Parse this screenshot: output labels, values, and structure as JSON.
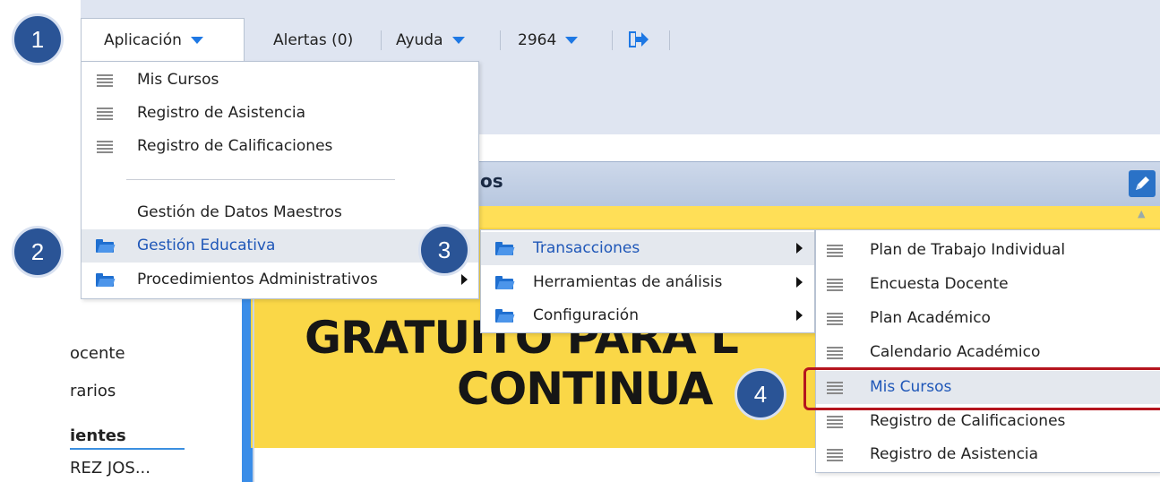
{
  "topbar": {
    "aplicacion_label": "Aplicación",
    "alertas_label": "Alertas (0)",
    "ayuda_label": "Ayuda",
    "user_code": "2964"
  },
  "panel": {
    "title_fragment": "os",
    "banner_line1": "GRATUITO PARA L",
    "banner_line2": "CONTINUA"
  },
  "left_side": {
    "item1": "ocente",
    "item2": "rarios",
    "section": "ientes",
    "person": "REZ JOS..."
  },
  "menu_aplicacion": {
    "items": [
      {
        "label": "Mis Cursos",
        "icon": "list-icon"
      },
      {
        "label": "Registro de Asistencia",
        "icon": "list-icon"
      },
      {
        "label": "Registro de Calificaciones",
        "icon": "list-icon"
      }
    ],
    "group_title": "Gestión de Datos Maestros",
    "folders": [
      {
        "label": "Gestión Educativa",
        "icon": "folder-icon",
        "highlighted": true
      },
      {
        "label": "Procedimientos Administrativos",
        "icon": "folder-icon"
      }
    ]
  },
  "menu_gestion_educativa": {
    "items": [
      {
        "label": "Transacciones",
        "icon": "folder-icon",
        "highlighted": true
      },
      {
        "label": "Herramientas de análisis",
        "icon": "folder-icon"
      },
      {
        "label": "Configuración",
        "icon": "folder-icon"
      }
    ]
  },
  "menu_transacciones": {
    "items": [
      {
        "label": "Plan de Trabajo Individual",
        "icon": "list-icon"
      },
      {
        "label": "Encuesta Docente",
        "icon": "list-icon"
      },
      {
        "label": "Plan Académico",
        "icon": "list-icon"
      },
      {
        "label": "Calendario Académico",
        "icon": "list-icon"
      },
      {
        "label": "Mis Cursos",
        "icon": "list-icon",
        "highlighted": true
      },
      {
        "label": "Registro de Calificaciones",
        "icon": "list-icon"
      },
      {
        "label": "Registro de Asistencia",
        "icon": "list-icon"
      }
    ]
  },
  "step_markers": [
    "1",
    "2",
    "3",
    "4"
  ],
  "colors": {
    "accent": "#1e78e4",
    "bubble": "#2a5496",
    "highlight_box": "#b5151e",
    "banner": "#fad747"
  }
}
